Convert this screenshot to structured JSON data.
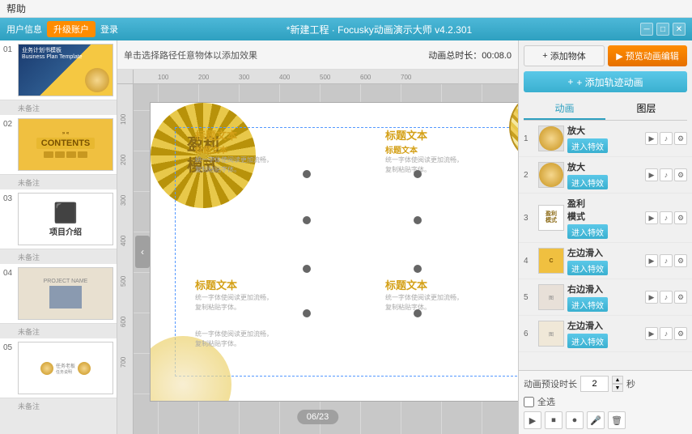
{
  "menubar": {
    "items": [
      "帮助"
    ]
  },
  "titlebar": {
    "title": "*新建工程 · Focusky动画演示大师 v4.2.301",
    "user": "用户信息",
    "upgrade": "升级账户",
    "login": "登录",
    "min": "─",
    "max": "□",
    "close": "✕"
  },
  "toolbar": {
    "hint": "单击选择路径任意物体以添加效果",
    "duration": "动画总时长：00:08.0"
  },
  "slides": [
    {
      "num": "01",
      "note": "未备注"
    },
    {
      "num": "02",
      "note": "未备注"
    },
    {
      "num": "03",
      "note": "未备注"
    },
    {
      "num": "04",
      "note": "未备注"
    },
    {
      "num": "05",
      "note": "未备注"
    }
  ],
  "canvas": {
    "page_indicator": "06/23"
  },
  "slide_content": {
    "title1": "标题文本",
    "title2": "标题文本",
    "title3": "标题文本",
    "title4": "标题文本",
    "sub1": "标题文本",
    "sub2": "标题文本",
    "center_text": "盈利\n模式",
    "body1": "统一字体使阅读更加流畅，\n复制粘贴字体。",
    "body2": "统一字体使阅读更加流畅，\n复制粘贴字体。",
    "body3": "统一字体使阅读更加流畅，\n复制粘贴字体。",
    "body4": "统一字体使阅读更加流畅，\n复制粘贴字体。",
    "body5": "统一字体使阅读更加流畅，\n复制粘贴字体。"
  },
  "right_panel": {
    "add_item_btn": "添加物体",
    "play_btn": "预览动画编辑",
    "add_anim_btn": "+ 添加轨迹动画",
    "tabs": [
      "动画",
      "图层"
    ],
    "animations": [
      {
        "num": "1",
        "name": "放大",
        "btn": "进入特效",
        "type": "gold"
      },
      {
        "num": "2",
        "name": "放大",
        "btn": "进入特效",
        "type": "gold"
      },
      {
        "num": "3",
        "name": "盈利\n模式",
        "btn": "进入特效",
        "type": "text"
      },
      {
        "num": "4",
        "name": "左边滑入",
        "btn": "进入特效",
        "type": "contents"
      },
      {
        "num": "5",
        "name": "右边滑入",
        "btn": "进入特效",
        "type": "slide5"
      },
      {
        "num": "6",
        "name": "左边滑入",
        "btn": "进入特效",
        "type": "slide6"
      }
    ],
    "duration_label": "动画预设时长",
    "duration_value": "2",
    "duration_unit": "秒",
    "select_all": "全选",
    "active_tab": "动画"
  }
}
